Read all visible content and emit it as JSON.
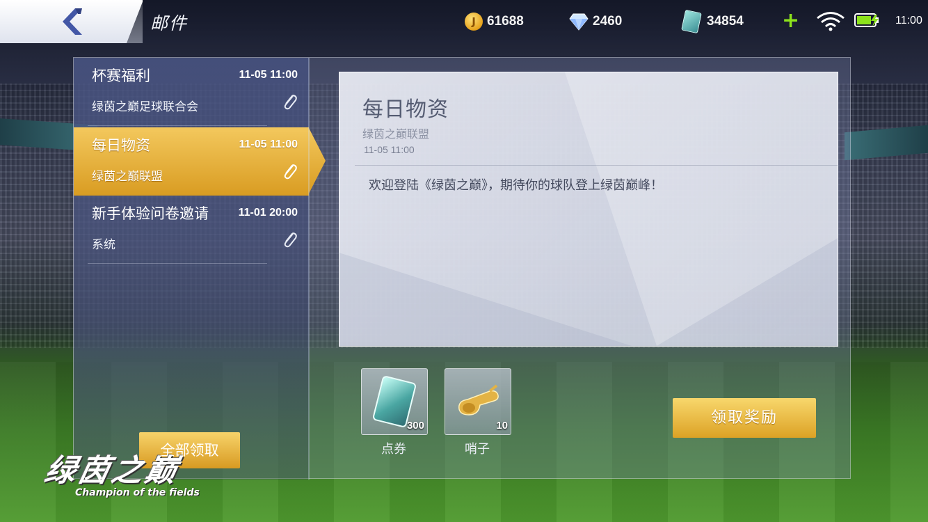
{
  "header": {
    "title": "邮件"
  },
  "currencies": [
    {
      "name": "coin",
      "icon": "coin-icon",
      "value": "61688",
      "glyph": "J"
    },
    {
      "name": "diamond",
      "icon": "diamond-icon",
      "value": "2460"
    },
    {
      "name": "ticket",
      "icon": "ticket-icon",
      "value": "34854"
    }
  ],
  "status": {
    "time": "11:00",
    "add": "+"
  },
  "mails": [
    {
      "title": "杯赛福利",
      "time": "11-05 11:00",
      "sender": "绿茵之巅足球联合会"
    },
    {
      "title": "每日物资",
      "time": "11-05 11:00",
      "sender": "绿茵之巅联盟"
    },
    {
      "title": "新手体验问卷邀请",
      "time": "11-01 20:00",
      "sender": "系统"
    }
  ],
  "content": {
    "title": "每日物资",
    "sender": "绿茵之巅联盟",
    "date": "11-05 11:00",
    "body": "欢迎登陆《绿茵之巅》，期待你的球队登上绿茵巅峰！"
  },
  "rewards": [
    {
      "name": "点券",
      "icon": "ticket-icon",
      "qty": "300"
    },
    {
      "name": "哨子",
      "icon": "whistle-icon",
      "qty": "10"
    }
  ],
  "buttons": {
    "claim": "领取奖励",
    "claim_all": "全部领取"
  },
  "logo": {
    "cn": "绿茵之巅",
    "en": "Champion of the fields"
  },
  "colors": {
    "accent_gold": "#e6aa2e",
    "plus_green": "#8de31c",
    "battery_green": "#8de31c"
  }
}
